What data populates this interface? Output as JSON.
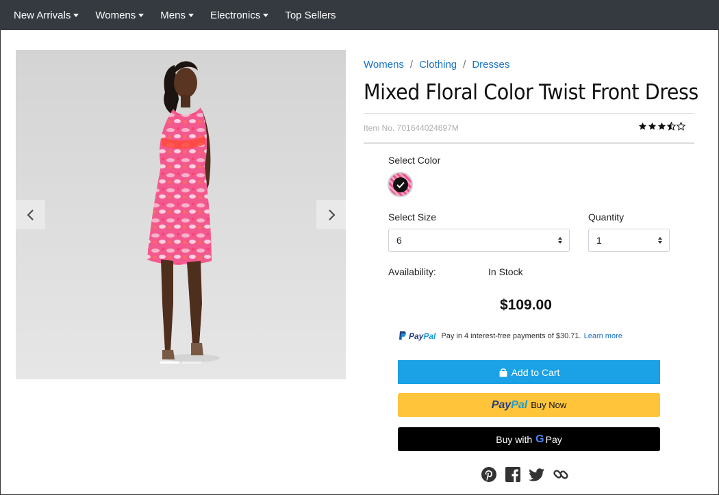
{
  "nav": {
    "items": [
      {
        "label": "New Arrivals",
        "dropdown": true
      },
      {
        "label": "Womens",
        "dropdown": true
      },
      {
        "label": "Mens",
        "dropdown": true
      },
      {
        "label": "Electronics",
        "dropdown": true
      },
      {
        "label": "Top Sellers",
        "dropdown": false
      }
    ]
  },
  "gallery": {
    "prev_icon": "chevron-left-icon",
    "next_icon": "chevron-right-icon",
    "slide_count": 2,
    "active_slide": 1
  },
  "breadcrumb": [
    "Womens",
    "Clothing",
    "Dresses"
  ],
  "breadcrumb_separator": "/",
  "product": {
    "title": "Mixed Floral Color Twist Front Dress",
    "item_no": "Item No. 701644024697M",
    "rating": 3.5,
    "rating_max": 5
  },
  "color": {
    "label": "Select Color",
    "selected_swatch": "pink-floral",
    "swatch_colors": [
      "#e9558e",
      "#f7a9c8"
    ]
  },
  "size": {
    "label": "Select Size",
    "value": "6"
  },
  "quantity": {
    "label": "Quantity",
    "value": "1"
  },
  "availability": {
    "label": "Availability:",
    "value": "In Stock"
  },
  "price": "$109.00",
  "paypal_message": {
    "logo_pay": "Pay",
    "logo_pal": "Pal",
    "text": "Pay in 4 interest-free payments of $30.71.",
    "link": "Learn more"
  },
  "buttons": {
    "add_to_cart": "Add to Cart",
    "paypal_pay": "Pay",
    "paypal_pal": "Pal",
    "paypal_suffix": "Buy Now",
    "gpay_prefix": "Buy with",
    "gpay_g": "G",
    "gpay_suffix": "Pay"
  },
  "social": [
    "pinterest-icon",
    "facebook-icon",
    "twitter-icon",
    "link-icon"
  ],
  "colors": {
    "nav_bg": "#343a40",
    "link": "#1a73c8",
    "add_to_cart": "#1aa1e6",
    "paypal_yellow": "#ffc439",
    "paypal_dark": "#253b80",
    "paypal_light": "#179bd7"
  }
}
